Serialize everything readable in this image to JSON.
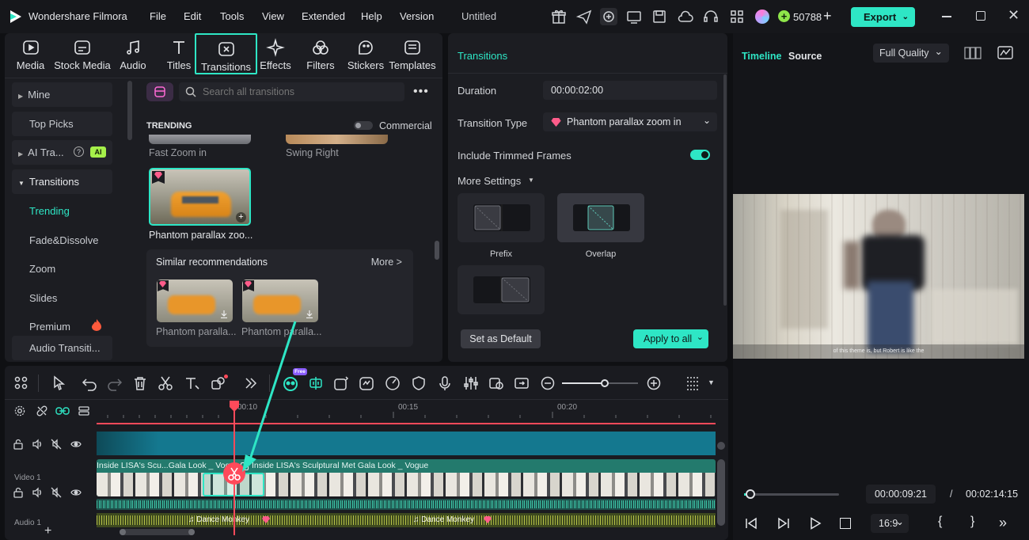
{
  "app": {
    "title": "Wondershare Filmora",
    "project": "Untitled",
    "credits": "50788",
    "export": "Export"
  },
  "menu": [
    "File",
    "Edit",
    "Tools",
    "View",
    "Extended",
    "Help",
    "Version"
  ],
  "tabs": [
    "Media",
    "Stock Media",
    "Audio",
    "Titles",
    "Transitions",
    "Effects",
    "Filters",
    "Stickers",
    "Templates"
  ],
  "categories": [
    "Mine",
    "Top Picks",
    "AI Tra...",
    "Transitions",
    "Trending",
    "Fade&Dissolve",
    "Zoom",
    "Slides",
    "Premium",
    "Audio Transiti..."
  ],
  "ai_badge": "AI",
  "search": {
    "placeholder": "Search all transitions"
  },
  "library": {
    "section": "TRENDING",
    "commercial": "Commercial",
    "items": [
      "Fast Zoom in",
      "Swing Right",
      "Phantom parallax zoo..."
    ],
    "similar": "Similar recommendations",
    "more": "More >",
    "similar_items": [
      "Phantom paralla...",
      "Phantom paralla..."
    ]
  },
  "settings": {
    "title": "Transitions",
    "duration_label": "Duration",
    "duration": "00:00:02:00",
    "type_label": "Transition Type",
    "type": "Phantom parallax zoom in",
    "trimmed_label": "Include Trimmed Frames",
    "more_settings": "More Settings",
    "modes": [
      "Prefix",
      "Overlap",
      ""
    ],
    "set_default": "Set as Default",
    "apply_all": "Apply to all"
  },
  "preview": {
    "tab_timeline": "Timeline",
    "tab_source": "Source",
    "quality": "Full Quality",
    "subtitle": "of this theme is, but Robert is like the",
    "current_time": "00:00:09:21",
    "separator": "/",
    "total_time": "00:02:14:15",
    "aspect": "16:9"
  },
  "timeline": {
    "ruler": [
      "00:10",
      "00:15",
      "00:20"
    ],
    "video_track": "Video 1",
    "audio_track": "Audio 1",
    "clip1": "Inside LISA's Scu...Gala Look _ Vogue",
    "clip2": "Inside LISA's Sculptural Met Gala Look _ Vogue",
    "audio_clip1": "Dance Monkey",
    "audio_clip2": "Dance Monkey",
    "ai_badge": "Free",
    "playhead_fraction": 0.23
  },
  "colors": {
    "accent": "#2ee6c5",
    "playhead": "#ff4a5a",
    "premium": "#ff5c8a"
  }
}
